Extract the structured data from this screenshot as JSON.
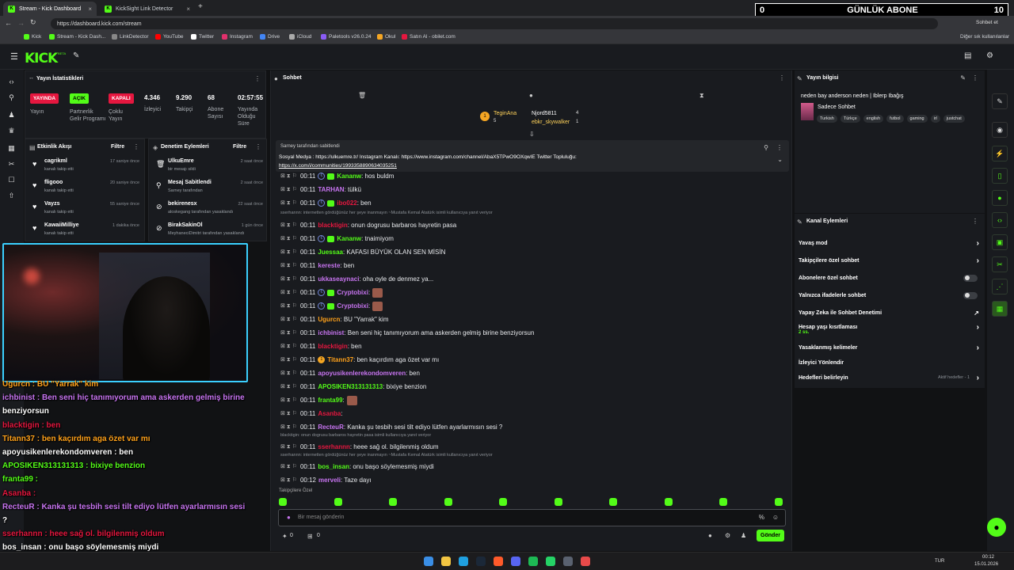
{
  "browser": {
    "tabs": [
      {
        "label": "Stream - Kick Dashboard"
      },
      {
        "label": "KickSight Link Detector"
      }
    ],
    "url": "https://dashboard.kick.com/stream",
    "bookmarks": [
      "Kick",
      "Stream - Kick Dash...",
      "LinkDetector",
      "YouTube",
      "Twitter",
      "Instagram",
      "Drive",
      "iCloud",
      "Paletools v26.0.24",
      "Okul",
      "Satın Al - obilet.com"
    ],
    "other_bookmarks": "Diğer sık kullanılanlar",
    "profile": "Sohbet et"
  },
  "overlay_counter": {
    "left": "0",
    "label": "GÜNLÜK ABONE",
    "right": "10"
  },
  "header": {
    "logo": "KICK",
    "beta": "BETA"
  },
  "stats": {
    "title": "Yayın İstatistikleri",
    "badges": [
      {
        "text": "YAYINDA",
        "label": "Yayın",
        "color": "#e5173f"
      },
      {
        "text": "AÇIK",
        "label": "Partnerlik Gelir Programı",
        "color": "#53fc18"
      },
      {
        "text": "KAPALI",
        "label": "Çoklu Yayın",
        "color": "#e5173f"
      }
    ],
    "values": [
      {
        "value": "4.346",
        "label": "İzleyici"
      },
      {
        "value": "9.290",
        "label": "Takipçi"
      },
      {
        "value": "68",
        "label": "Abone Sayısı"
      },
      {
        "value": "02:57:55",
        "label": "Yayında Olduğu Süre"
      }
    ]
  },
  "activity": {
    "title": "Etkinlik Akışı",
    "filter": "Filtre",
    "items": [
      {
        "name": "cagrikml",
        "sub": "kanalı takip etti",
        "time": "17 saniye önce"
      },
      {
        "name": "fligooo",
        "sub": "kanalı takip etti",
        "time": "20 saniye önce"
      },
      {
        "name": "Vayzs",
        "sub": "kanalı takip etti",
        "time": "55 saniye önce"
      },
      {
        "name": "KawaiiMilliye",
        "sub": "kanalı takip etti",
        "time": "1 dakika önce"
      }
    ]
  },
  "moderation": {
    "title": "Denetim Eylemleri",
    "filter": "Filtre",
    "items": [
      {
        "name": "UlkuEmre",
        "sub": "bir mesajı sildi",
        "time": "2 saat önce"
      },
      {
        "name": "Mesaj Sabitlendi",
        "sub": "Sarney tarafından",
        "time": "2 saat önce"
      },
      {
        "name": "bekirenesx",
        "sub": "aloskegang tarafından yasaklandı",
        "time": "22 saat önce"
      },
      {
        "name": "BirakSakinOl",
        "sub": "MeyhaneciDimitri tarafından yasaklandı",
        "time": "1 gün önce"
      }
    ]
  },
  "overlay_chat": [
    "Ugurcn : BU \"Yarrak\" kim",
    "ichbinist : Ben seni hiç tanımıyorum ama askerden gelmiş birine",
    "benziyorsun",
    "blacktigin : ben",
    "Titann37 : ben kaçırdım aga özet var mı",
    "apoyusikenlerekondomveren : ben",
    "APOSIKEN313131313 : bixiye benzion",
    "franta99 :",
    "Asanba :",
    "RecteuR : Kanka şu tesbih sesi tilt ediyo lütfen ayarlarmısın sesi",
    "?",
    "sserhannn : heee sağ ol. bilgilenmiş oldum",
    "bos_insan : onu başo söylemesmiş miydi",
    "merveli : Taze dayı"
  ],
  "chat": {
    "title": "Sohbet",
    "top": [
      {
        "name": "TeginAna",
        "count": "5"
      },
      {
        "name": "Njord5811",
        "count": "4"
      },
      {
        "name": "ebkr_skywalker",
        "count": "1"
      }
    ],
    "pinned_by": "Sarney tarafından sabitlendi",
    "pinned_text": "Sosyal Medya : https://ulkuemre.tr/ Instagram Kanalı: https://www.instagram.com/channel/AbaX5TPwO9OXqwIE Twitter Topluluğu:",
    "pinned_link": "https://x.com/i/communities/1993358890634035251",
    "messages": [
      {
        "t": "00:11",
        "u": "Kananw",
        "c": "#53fc18",
        "m": ": hos buldm"
      },
      {
        "t": "00:11",
        "u": "TARHAN",
        "c": "#c774f0",
        "m": ": tülkü"
      },
      {
        "t": "00:11",
        "u": "ibo022",
        "c": "#e5173f",
        "m": ": ben"
      },
      {
        "t": "00:11",
        "u": "blacktigin",
        "c": "#e5173f",
        "m": ": onun dogrusu barbaros hayretin pasa"
      },
      {
        "t": "00:11",
        "u": "Kananw",
        "c": "#53fc18",
        "m": ": tnaimiyom"
      },
      {
        "t": "00:11",
        "u": "Juessaa",
        "c": "#53fc18",
        "m": ": KAFASI BÜYÜK OLAN SEN MİSİN"
      },
      {
        "t": "00:11",
        "u": "kereste",
        "c": "#c774f0",
        "m": ": ben"
      },
      {
        "t": "00:11",
        "u": "ukkaseaynaci",
        "c": "#c774f0",
        "m": ": oha oyle de denmez ya..."
      },
      {
        "t": "00:11",
        "u": "Cryptobixi",
        "c": "#c774f0",
        "m": ":"
      },
      {
        "t": "00:11",
        "u": "Cryptobixi",
        "c": "#c774f0",
        "m": ":"
      },
      {
        "t": "00:11",
        "u": "Ugurcn",
        "c": "#ffa11a",
        "m": ": BU \"Yarrak\" kim"
      },
      {
        "t": "00:11",
        "u": "ichbinist",
        "c": "#c774f0",
        "m": ": Ben seni hiç tanımıyorum ama askerden gelmiş birine benziyorsun"
      },
      {
        "t": "00:11",
        "u": "blacktigin",
        "c": "#e5173f",
        "m": ": ben"
      },
      {
        "t": "00:11",
        "u": "Titann37",
        "c": "#ffa11a",
        "m": ": ben kaçırdım aga özet var mı"
      },
      {
        "t": "00:11",
        "u": "apoyusikenlerekondomveren",
        "c": "#c774f0",
        "m": ": ben"
      },
      {
        "t": "00:11",
        "u": "APOSIKEN313131313",
        "c": "#53fc18",
        "m": ": bixiye benzion"
      },
      {
        "t": "00:11",
        "u": "franta99",
        "c": "#53fc18",
        "m": ":"
      },
      {
        "t": "00:11",
        "u": "Asanba",
        "c": "#e5173f",
        "m": ":"
      },
      {
        "t": "00:11",
        "u": "RecteuR",
        "c": "#c774f0",
        "m": ": Kanka şu tesbih sesi tilt ediyo lütfen ayarlarmısın sesi ?"
      },
      {
        "t": "00:11",
        "u": "sserhannn",
        "c": "#e5173f",
        "m": ": heee sağ ol. bilgilenmiş oldum"
      },
      {
        "t": "00:11",
        "u": "bos_insan",
        "c": "#53fc18",
        "m": ": onu başo söylemesmiş miydi"
      },
      {
        "t": "00:12",
        "u": "merveli",
        "c": "#c774f0",
        "m": ": Taze dayı"
      }
    ],
    "reply1": "sserhannn: internetten gördüğünüz her şeye inanmayın ~Mustafa Kemal Atatürk isimli kullanıcıya yanıt veriyor",
    "reply2": "blacktigin: onun dogrusu barbaros hayretin pasa isimli kullanıcıya yanıt veriyor",
    "reply3": "sserhannn: internetten gördüğünüz her şeye inanmayın ~Mustafa Kemal Atatürk isimli kullanıcıya yanıt veriyor",
    "followers_only": "Takipçilere Özel",
    "placeholder": "Bir mesaj gönderin",
    "count_a": "0",
    "count_b": "0",
    "send": "Gönder"
  },
  "stream_info": {
    "title": "Yayın bilgisi",
    "stream_title": "neden bay anderson neden | Iblerp Ibağış",
    "category": "Sadece Sohbet",
    "tags": [
      "Turkish",
      "Türkçe",
      "english",
      "futbol",
      "gaming",
      "irl",
      "justchat"
    ]
  },
  "channel_actions": {
    "title": "Kanal Eylemleri",
    "rows": [
      {
        "label": "Yavaş mod",
        "kind": "chev"
      },
      {
        "label": "Takipçilere özel sohbet",
        "kind": "chev"
      },
      {
        "label": "Abonelere özel sohbet",
        "kind": "toggle"
      },
      {
        "label": "Yalnızca ifadelerle sohbet",
        "kind": "toggle"
      },
      {
        "label": "Yapay Zeka ile Sohbet Denetimi",
        "kind": "link"
      },
      {
        "label": "Hesap yaşı kısıtlaması",
        "kind": "chev",
        "sub": "2 ss."
      },
      {
        "label": "Yasaklanmış kelimeler",
        "kind": "chev"
      },
      {
        "label": "İzleyici Yönlendir",
        "kind": "none"
      },
      {
        "label": "Hedefleri belirleyin",
        "kind": "chev",
        "extra": "Aktif hedefler - 1"
      }
    ]
  },
  "taskbar": {
    "lang": "TUR",
    "time": "00:12",
    "date": "15.01.2026"
  }
}
